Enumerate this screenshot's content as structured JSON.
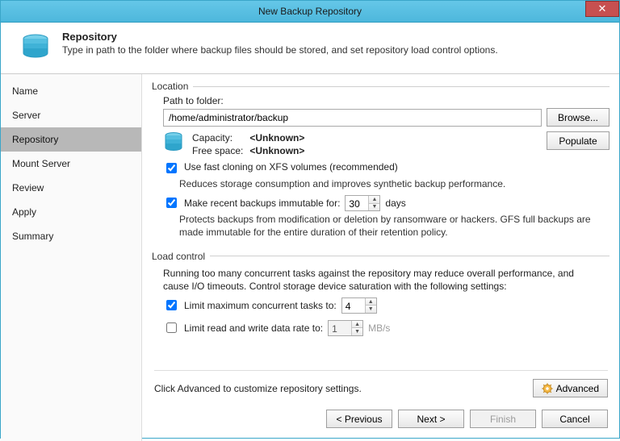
{
  "window": {
    "title": "New Backup Repository"
  },
  "header": {
    "title": "Repository",
    "subtitle": "Type in path to the folder where backup files should be stored, and set repository load control options."
  },
  "nav": {
    "items": [
      {
        "label": "Name"
      },
      {
        "label": "Server"
      },
      {
        "label": "Repository",
        "active": true
      },
      {
        "label": "Mount Server"
      },
      {
        "label": "Review"
      },
      {
        "label": "Apply"
      },
      {
        "label": "Summary"
      }
    ]
  },
  "location": {
    "legend": "Location",
    "path_label": "Path to folder:",
    "path_value": "/home/administrator/backup",
    "browse": "Browse...",
    "populate": "Populate",
    "capacity_label": "Capacity:",
    "capacity_value": "<Unknown>",
    "free_label": "Free space:",
    "free_value": "<Unknown>",
    "fastclone_label": "Use fast cloning on XFS volumes (recommended)",
    "fastclone_desc": "Reduces storage consumption and improves synthetic backup performance.",
    "immutable_label_pre": "Make recent backups immutable for:",
    "immutable_days": "30",
    "immutable_label_post": "days",
    "immutable_desc": "Protects backups from modification or deletion by ransomware or hackers. GFS full backups are made immutable for the entire duration of their retention policy."
  },
  "load": {
    "legend": "Load control",
    "desc": "Running too many concurrent tasks against the repository may reduce overall performance, and cause I/O timeouts. Control storage device saturation with the following settings:",
    "limit_tasks_label": "Limit maximum concurrent tasks to:",
    "limit_tasks_value": "4",
    "limit_rate_label": "Limit read and write data rate to:",
    "limit_rate_value": "1",
    "limit_rate_unit": "MB/s"
  },
  "footer": {
    "advanced_hint": "Click Advanced to customize repository settings.",
    "advanced": "Advanced",
    "previous": "< Previous",
    "next": "Next >",
    "finish": "Finish",
    "cancel": "Cancel"
  }
}
